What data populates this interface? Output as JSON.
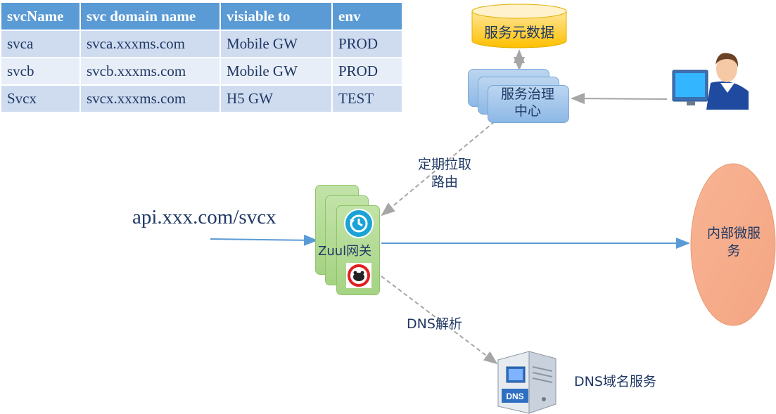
{
  "table": {
    "headers": [
      "svcName",
      "svc domain name",
      "visiable to",
      "env"
    ],
    "rows": [
      [
        "svca",
        "svca.xxxms.com",
        "Mobile GW",
        "PROD"
      ],
      [
        "svcb",
        "svcb.xxxms.com",
        "Mobile GW",
        "PROD"
      ],
      [
        "Svcx",
        "svcx.xxxms.com",
        "H5 GW",
        "TEST"
      ]
    ]
  },
  "nodes": {
    "metadata": "服务元数据",
    "governance_line1": "服务治理",
    "governance_line2": "中心",
    "gateway": "Zuul网关",
    "internal_line1": "内部微服",
    "internal_line2": "务",
    "dns_service": "DNS域名服务"
  },
  "edges": {
    "request_url": "api.xxx.com/svcx",
    "pull_line1": "定期拉取",
    "pull_line2": "路由",
    "dns_resolve": "DNS解析"
  },
  "icons": {
    "dns_server_badge": "DNS",
    "admin_user": "user-at-computer-icon",
    "gateway_history": "history-icon",
    "gateway_shield": "blocked-face-icon"
  },
  "colors": {
    "table_header": "#5b9bd5",
    "governance": "#9dc3e6",
    "gateway": "#a9d18e",
    "internal": "#f4a582",
    "metadata": "#ffd966",
    "arrow_blue": "#5b9bd5",
    "arrow_gray": "#a6a6a6"
  }
}
